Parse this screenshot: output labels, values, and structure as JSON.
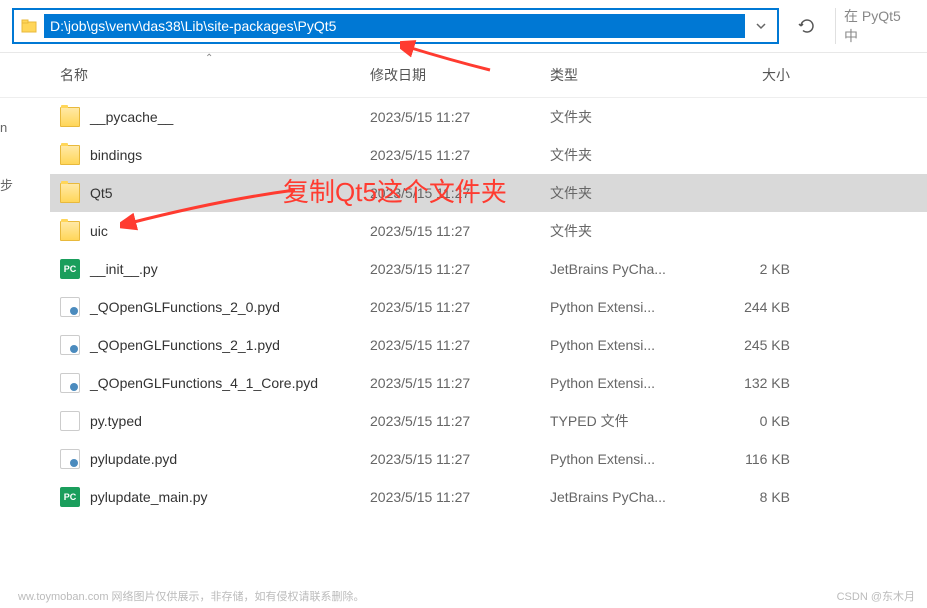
{
  "toolbar": {
    "path": "D:\\job\\gs\\venv\\das38\\Lib\\site-packages\\PyQt5",
    "search_placeholder": "在 PyQt5 中"
  },
  "columns": {
    "name": "名称",
    "date": "修改日期",
    "type": "类型",
    "size": "大小"
  },
  "files": [
    {
      "name": "__pycache__",
      "date": "2023/5/15 11:27",
      "type": "文件夹",
      "size": "",
      "icon": "folder"
    },
    {
      "name": "bindings",
      "date": "2023/5/15 11:27",
      "type": "文件夹",
      "size": "",
      "icon": "folder"
    },
    {
      "name": "Qt5",
      "date": "2023/5/15 11:27",
      "type": "文件夹",
      "size": "",
      "icon": "folder",
      "selected": true
    },
    {
      "name": "uic",
      "date": "2023/5/15 11:27",
      "type": "文件夹",
      "size": "",
      "icon": "folder"
    },
    {
      "name": "__init__.py",
      "date": "2023/5/15 11:27",
      "type": "JetBrains PyCha...",
      "size": "2 KB",
      "icon": "pc"
    },
    {
      "name": "_QOpenGLFunctions_2_0.pyd",
      "date": "2023/5/15 11:27",
      "type": "Python Extensi...",
      "size": "244 KB",
      "icon": "pyd"
    },
    {
      "name": "_QOpenGLFunctions_2_1.pyd",
      "date": "2023/5/15 11:27",
      "type": "Python Extensi...",
      "size": "245 KB",
      "icon": "pyd"
    },
    {
      "name": "_QOpenGLFunctions_4_1_Core.pyd",
      "date": "2023/5/15 11:27",
      "type": "Python Extensi...",
      "size": "132 KB",
      "icon": "pyd"
    },
    {
      "name": "py.typed",
      "date": "2023/5/15 11:27",
      "type": "TYPED 文件",
      "size": "0 KB",
      "icon": "typed"
    },
    {
      "name": "pylupdate.pyd",
      "date": "2023/5/15 11:27",
      "type": "Python Extensi...",
      "size": "116 KB",
      "icon": "pyd"
    },
    {
      "name": "pylupdate_main.py",
      "date": "2023/5/15 11:27",
      "type": "JetBrains PyCha...",
      "size": "8 KB",
      "icon": "pc"
    }
  ],
  "annotation": {
    "text": "复制Qt5这个文件夹"
  },
  "left_edge": {
    "item1": "n",
    "item2": "步"
  },
  "watermark": {
    "left": "ww.toymoban.com   网络图片仅供展示，非存储，如有侵权请联系删除。",
    "right": "CSDN @东木月"
  }
}
